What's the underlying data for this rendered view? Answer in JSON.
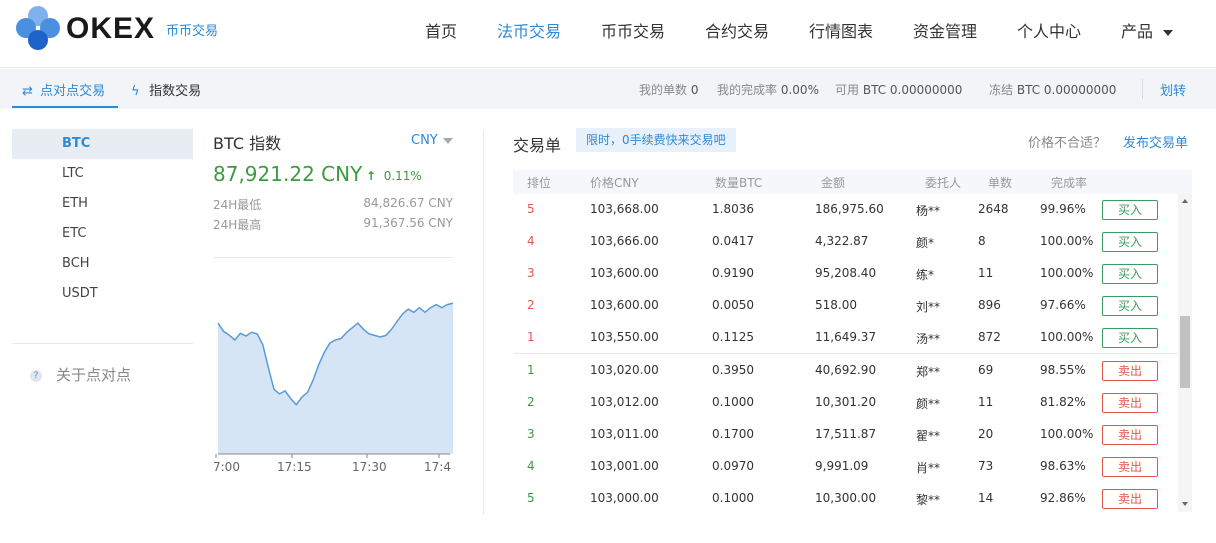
{
  "brand": {
    "name": "OKEX",
    "subtitle": "币币交易"
  },
  "nav": [
    "首页",
    "法币交易",
    "币币交易",
    "合约交易",
    "行情图表",
    "资金管理",
    "个人中心",
    "产品"
  ],
  "nav_active": "法币交易",
  "subnav": {
    "tabs": [
      {
        "label": "点对点交易",
        "icon": "swap-icon"
      },
      {
        "label": "指数交易",
        "icon": "lightning-icon"
      }
    ],
    "stats": [
      {
        "label": "我的单数",
        "value": "0"
      },
      {
        "label": "我的完成率",
        "value": "0.00%"
      },
      {
        "label": "可用",
        "value": "BTC  0.00000000"
      },
      {
        "label": "冻结",
        "value": "BTC  0.00000000"
      }
    ],
    "transfer": "划转"
  },
  "coins": [
    "BTC",
    "LTC",
    "ETH",
    "ETC",
    "BCH",
    "USDT"
  ],
  "coin_active": "BTC",
  "about": "关于点对点",
  "index": {
    "title": "BTC 指数",
    "currency": "CNY",
    "price": "87,921.22 CNY",
    "change": "0.11%",
    "low_label": "24H最低",
    "low_value": "84,826.67 CNY",
    "high_label": "24H最高",
    "high_value": "91,367.56 CNY"
  },
  "chart_data": {
    "type": "area",
    "x_ticks": [
      "7:00",
      "17:15",
      "17:30",
      "17:4"
    ],
    "values": [
      92.5,
      89.8,
      88.6,
      87.0,
      89.2,
      88.3,
      89.5,
      89.0,
      85.5,
      78.0,
      71.0,
      69.5,
      70.5,
      68.0,
      66.0,
      68.5,
      70.0,
      74.0,
      79.0,
      83.0,
      86.0,
      87.0,
      87.5,
      89.5,
      91.0,
      92.5,
      90.5,
      89.0,
      88.5,
      88.0,
      88.5,
      90.5,
      93.0,
      95.5,
      97.0,
      96.0,
      97.5,
      96.0,
      97.5,
      98.5,
      97.5,
      98.5,
      99.0
    ],
    "color": "#5b9bd5",
    "fill": "#d6e5f6"
  },
  "orderbook": {
    "title": "交易单",
    "tip": "限时，0手续费快来交易吧",
    "hint": "价格不合适？",
    "publish": "发布交易单",
    "headers": [
      "排位",
      "价格CNY",
      "数量BTC",
      "金额",
      "委托人",
      "单数",
      "完成率"
    ],
    "buy_label": "买入",
    "sell_label": "卖出",
    "buy_rows": [
      {
        "rank": "5",
        "price": "103,668.00",
        "qty": "1.8036",
        "amount": "186,975.60",
        "user": "杨**",
        "orders": "2648",
        "rate": "99.96%"
      },
      {
        "rank": "4",
        "price": "103,666.00",
        "qty": "0.0417",
        "amount": "4,322.87",
        "user": "颜*",
        "orders": "8",
        "rate": "100.00%"
      },
      {
        "rank": "3",
        "price": "103,600.00",
        "qty": "0.9190",
        "amount": "95,208.40",
        "user": "练*",
        "orders": "11",
        "rate": "100.00%"
      },
      {
        "rank": "2",
        "price": "103,600.00",
        "qty": "0.0050",
        "amount": "518.00",
        "user": "刘**",
        "orders": "896",
        "rate": "97.66%"
      },
      {
        "rank": "1",
        "price": "103,550.00",
        "qty": "0.1125",
        "amount": "11,649.37",
        "user": "汤**",
        "orders": "872",
        "rate": "100.00%"
      }
    ],
    "sell_rows": [
      {
        "rank": "1",
        "price": "103,020.00",
        "qty": "0.3950",
        "amount": "40,692.90",
        "user": "郑**",
        "orders": "69",
        "rate": "98.55%"
      },
      {
        "rank": "2",
        "price": "103,012.00",
        "qty": "0.1000",
        "amount": "10,301.20",
        "user": "颜**",
        "orders": "11",
        "rate": "81.82%"
      },
      {
        "rank": "3",
        "price": "103,011.00",
        "qty": "0.1700",
        "amount": "17,511.87",
        "user": "翟**",
        "orders": "20",
        "rate": "100.00%"
      },
      {
        "rank": "4",
        "price": "103,001.00",
        "qty": "0.0970",
        "amount": "9,991.09",
        "user": "肖**",
        "orders": "73",
        "rate": "98.63%"
      },
      {
        "rank": "5",
        "price": "103,000.00",
        "qty": "0.1000",
        "amount": "10,300.00",
        "user": "黎**",
        "orders": "14",
        "rate": "92.86%"
      }
    ]
  }
}
